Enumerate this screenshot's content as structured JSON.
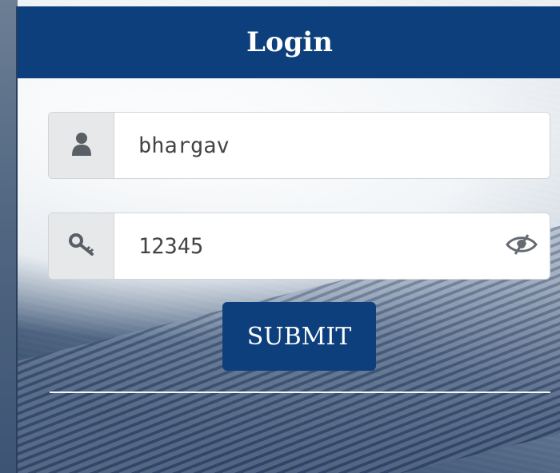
{
  "login": {
    "title": "Login",
    "username": {
      "value": "bhargav",
      "icon": "user-icon"
    },
    "password": {
      "value": "12345",
      "icon": "key-icon",
      "toggle_icon": "eye-slash-icon"
    },
    "submit_label": "SUBMIT"
  },
  "colors": {
    "header": "#0c3f7c",
    "button": "#0c3f7c",
    "addon": "#e6e8ea"
  }
}
